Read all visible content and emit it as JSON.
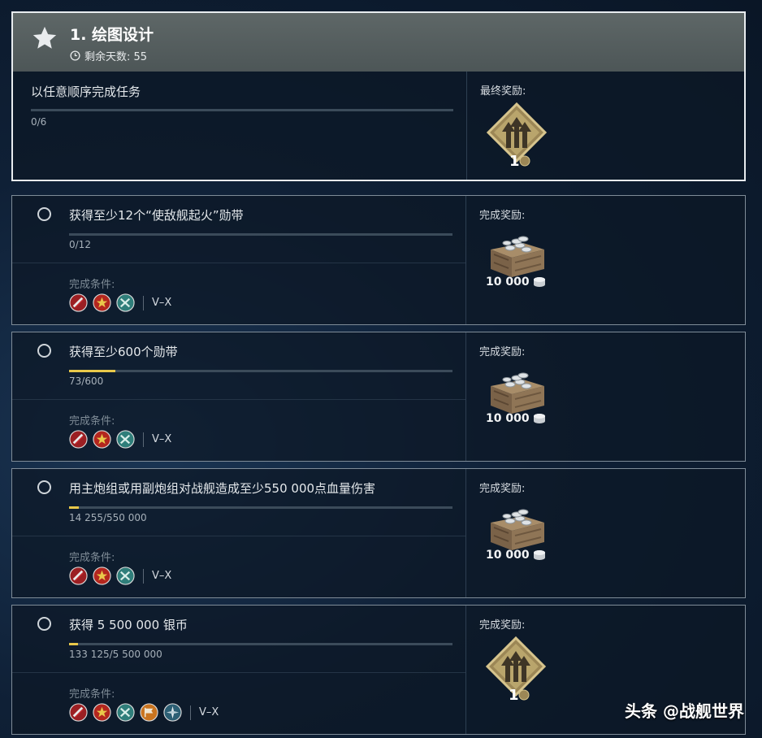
{
  "header": {
    "title": "1. 绘图设计",
    "days_label": "剩余天数: 55"
  },
  "main": {
    "task_text": "以任意顺序完成任务",
    "progress": "0/6",
    "progress_fraction": 0,
    "reward_label": "最终奖励:",
    "reward_count": "1"
  },
  "quests": [
    {
      "text": "获得至少12个“使敌舰起火”勋带",
      "progress": "0/12",
      "progress_fraction": 0,
      "cond_label": "完成条件:",
      "tier": "V–X",
      "reward_label": "完成奖励:",
      "reward_amount": "10 000"
    },
    {
      "text": "获得至少600个勋带",
      "progress": "73/600",
      "progress_fraction": 0.12,
      "cond_label": "完成条件:",
      "tier": "V–X",
      "reward_label": "完成奖励:",
      "reward_amount": "10 000"
    },
    {
      "text": "用主炮组或用副炮组对战舰造成至少550 000点血量伤害",
      "progress": "14 255/550 000",
      "progress_fraction": 0.026,
      "cond_label": "完成条件:",
      "tier": "V–X",
      "reward_label": "完成奖励:",
      "reward_amount": "10 000"
    },
    {
      "text": "获得 5 500 000 银币",
      "progress": "133 125/5 500 000",
      "progress_fraction": 0.024,
      "cond_label": "完成条件:",
      "tier": "V–X",
      "reward_label": "完成奖励:",
      "reward_count": "1"
    }
  ],
  "watermark": "头条 @战舰世界",
  "colors": {
    "progress": "#e8c84a",
    "card_border": "#7f8c98"
  }
}
